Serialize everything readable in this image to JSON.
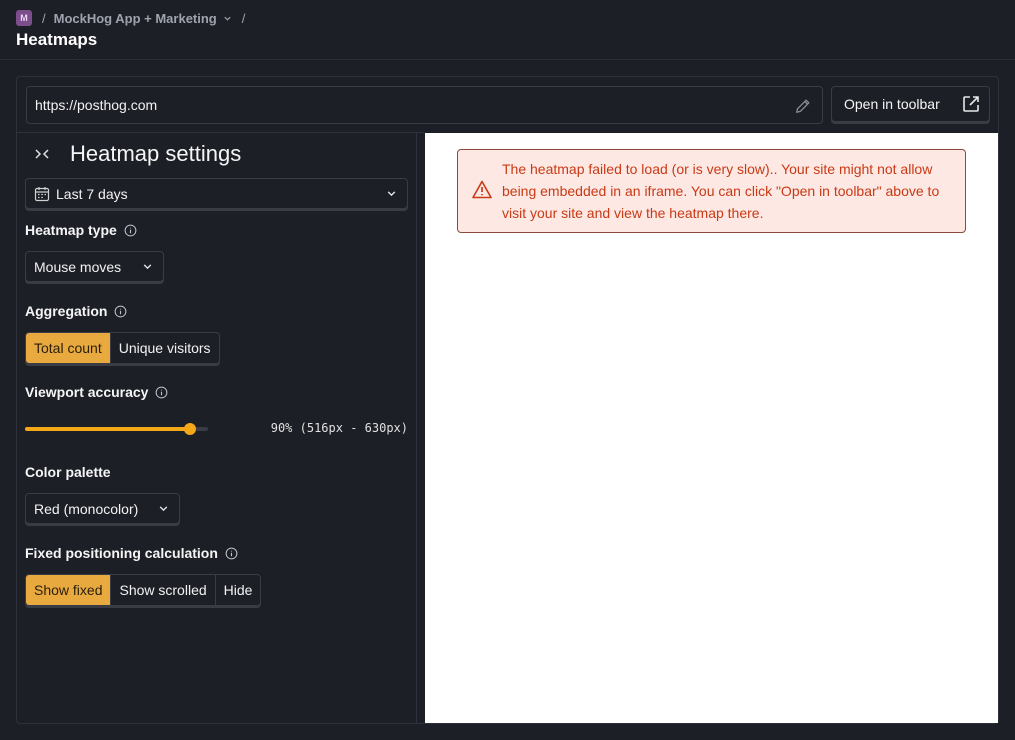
{
  "breadcrumb": {
    "project_badge": "M",
    "separator": "/",
    "project_name": "MockHog App + Marketing",
    "trailing_separator": "/"
  },
  "page": {
    "title": "Heatmaps"
  },
  "url_bar": {
    "value": "https://posthog.com"
  },
  "toolbar_button": {
    "label": "Open in toolbar"
  },
  "settings": {
    "title": "Heatmap settings",
    "date_range": "Last 7 days",
    "heatmap_type": {
      "label": "Heatmap type",
      "value": "Mouse moves"
    },
    "aggregation": {
      "label": "Aggregation",
      "options": [
        "Total count",
        "Unique visitors"
      ],
      "selected": "Total count"
    },
    "viewport_accuracy": {
      "label": "Viewport accuracy",
      "value_percent": 90,
      "readout": "90% (516px - 630px)"
    },
    "color_palette": {
      "label": "Color palette",
      "value": "Red (monocolor)"
    },
    "fixed_positioning": {
      "label": "Fixed positioning calculation",
      "options": [
        "Show fixed",
        "Show scrolled",
        "Hide"
      ],
      "selected": "Show fixed"
    }
  },
  "preview": {
    "error_message": "The heatmap failed to load (or is very slow).. Your site might not allow being embedded in an iframe. You can click \"Open in toolbar\" above to visit your site and view the heatmap there."
  },
  "colors": {
    "accent": "#f5a817",
    "active_segment": "#e8a93f",
    "error_text": "#c93a16",
    "error_bg": "#fde8e3"
  }
}
